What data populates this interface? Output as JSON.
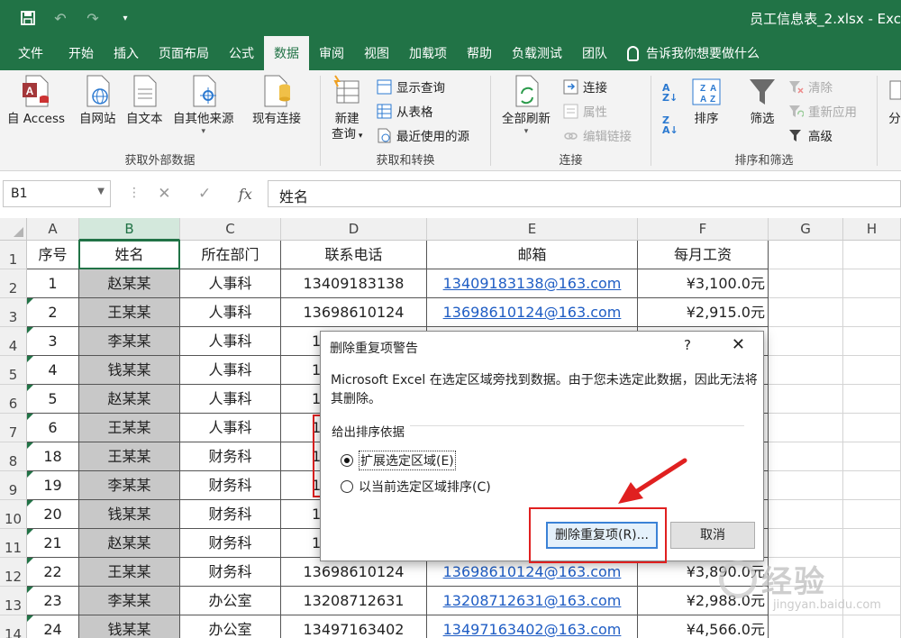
{
  "titlebar": {
    "doc_title": "员工信息表_2.xlsx - Exc"
  },
  "tabs": [
    {
      "label": "文件",
      "active": false
    },
    {
      "label": "开始",
      "active": false
    },
    {
      "label": "插入",
      "active": false
    },
    {
      "label": "页面布局",
      "active": false
    },
    {
      "label": "公式",
      "active": false
    },
    {
      "label": "数据",
      "active": true
    },
    {
      "label": "审阅",
      "active": false
    },
    {
      "label": "视图",
      "active": false
    },
    {
      "label": "加载项",
      "active": false
    },
    {
      "label": "帮助",
      "active": false
    },
    {
      "label": "负载测试",
      "active": false
    },
    {
      "label": "团队",
      "active": false
    }
  ],
  "tell_me": "告诉我你想要做什么",
  "ribbon": {
    "get_external": {
      "label": "获取外部数据",
      "access": "自 Access",
      "web": "自网站",
      "text": "自文本",
      "other": "自其他来源",
      "existing": "现有连接"
    },
    "transform": {
      "label": "获取和转换",
      "new_query": "新建",
      "new_query_2": "查询",
      "show_queries": "显示查询",
      "from_table": "从表格",
      "recent": "最近使用的源"
    },
    "connections": {
      "label": "连接",
      "refresh_all": "全部刷新",
      "connections": "连接",
      "properties": "属性",
      "edit_links": "编辑链接"
    },
    "sort_filter": {
      "label": "排序和筛选",
      "sort": "排序",
      "filter": "筛选",
      "clear": "清除",
      "reapply": "重新应用",
      "advanced": "高级",
      "cut_off": "分"
    }
  },
  "formula_bar": {
    "name_box": "B1",
    "formula": "姓名"
  },
  "columns": [
    "A",
    "B",
    "C",
    "D",
    "E",
    "F",
    "G",
    "H"
  ],
  "rows": [
    {
      "n": "1",
      "a": "序号",
      "b": "姓名",
      "c": "所在部门",
      "d": "联系电话",
      "e": "邮箱",
      "f": "每月工资"
    },
    {
      "n": "2",
      "a": "1",
      "b": "赵某某",
      "c": "人事科",
      "d": "13409183138",
      "e": "13409183138@163.com",
      "f": "¥3,100.0元"
    },
    {
      "n": "3",
      "a": "2",
      "b": "王某某",
      "c": "人事科",
      "d": "13698610124",
      "e": "13698610124@163.com",
      "f": "¥2,915.0元"
    },
    {
      "n": "4",
      "a": "3",
      "b": "李某某",
      "c": "人事科",
      "d": "13",
      "e": "",
      "f": ""
    },
    {
      "n": "5",
      "a": "4",
      "b": "钱某某",
      "c": "人事科",
      "d": "13",
      "e": "",
      "f": ""
    },
    {
      "n": "6",
      "a": "5",
      "b": "赵某某",
      "c": "人事科",
      "d": "13",
      "e": "",
      "f": ""
    },
    {
      "n": "7",
      "a": "6",
      "b": "王某某",
      "c": "人事科",
      "d": "13",
      "e": "",
      "f": ""
    },
    {
      "n": "8",
      "a": "18",
      "b": "王某某",
      "c": "财务科",
      "d": "13",
      "e": "",
      "f": ""
    },
    {
      "n": "9",
      "a": "19",
      "b": "李某某",
      "c": "财务科",
      "d": "13",
      "e": "",
      "f": ""
    },
    {
      "n": "10",
      "a": "20",
      "b": "钱某某",
      "c": "财务科",
      "d": "13",
      "e": "",
      "f": ""
    },
    {
      "n": "11",
      "a": "21",
      "b": "赵某某",
      "c": "财务科",
      "d": "13",
      "e": "",
      "f": ""
    },
    {
      "n": "12",
      "a": "22",
      "b": "王某某",
      "c": "财务科",
      "d": "13698610124",
      "e": "13698610124@163.com",
      "f": "¥3,890.0元"
    },
    {
      "n": "13",
      "a": "23",
      "b": "李某某",
      "c": "办公室",
      "d": "13208712631",
      "e": "13208712631@163.com",
      "f": "¥2,988.0元"
    },
    {
      "n": "14",
      "a": "24",
      "b": "钱某某",
      "c": "办公室",
      "d": "13497163402",
      "e": "13497163402@163.com",
      "f": "¥4,566.0元"
    }
  ],
  "dialog": {
    "title": "删除重复项警告",
    "help": "?",
    "close": "✕",
    "message": "Microsoft Excel 在选定区域旁找到数据。由于您未选定此数据，因此无法将其删除。",
    "group_label": "给出排序依据",
    "option_expand": "扩展选定区域(E)",
    "option_current": "以当前选定区域排序(C)",
    "remove_btn": "删除重复项(R)...",
    "cancel_btn": "取消"
  },
  "watermark": {
    "text": "经验",
    "sub": "jingyan.baidu.com"
  },
  "colors": {
    "excel_green": "#217346",
    "highlight_red": "#e02020",
    "link": "#1f5dc4"
  }
}
